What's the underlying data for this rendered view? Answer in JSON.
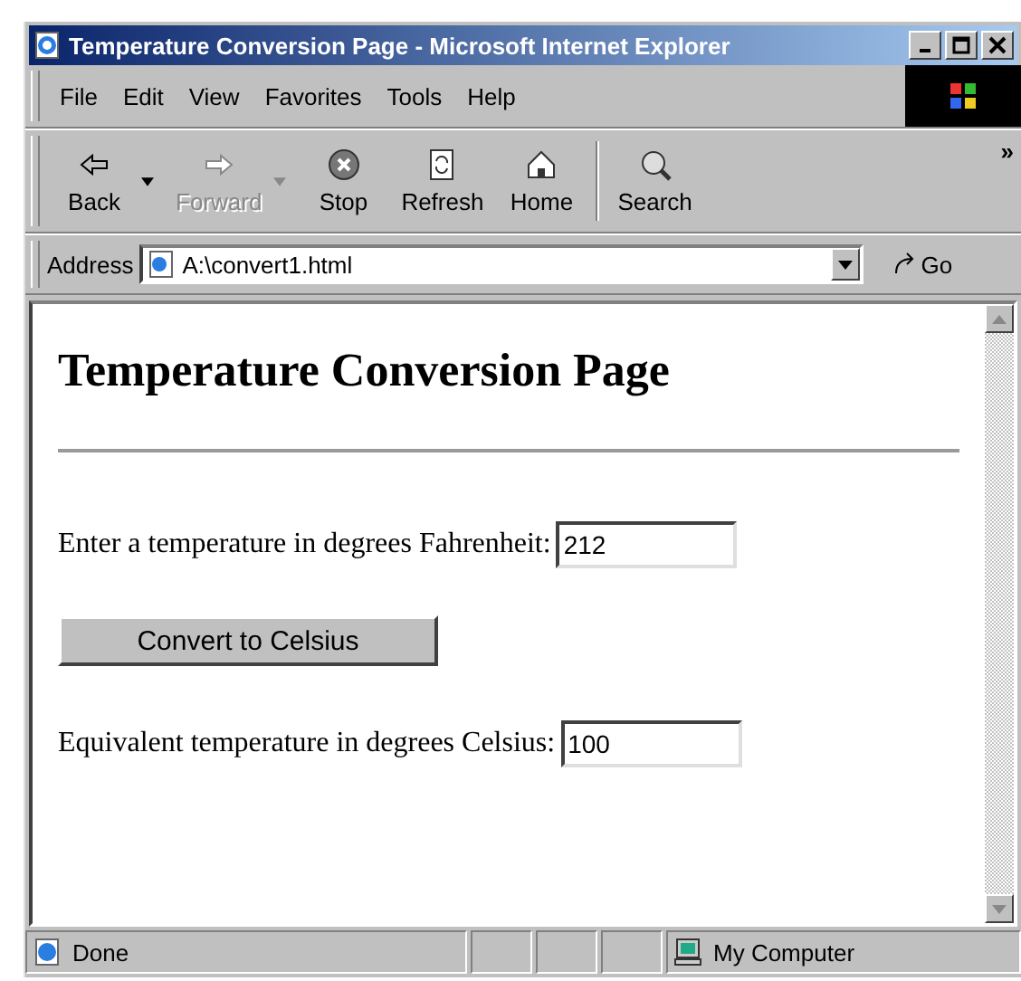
{
  "window": {
    "title": "Temperature Conversion Page - Microsoft Internet Explorer"
  },
  "menu": [
    "File",
    "Edit",
    "View",
    "Favorites",
    "Tools",
    "Help"
  ],
  "toolbar": [
    {
      "kind": "back",
      "label": "Back",
      "disabled": false,
      "dropdown": true
    },
    {
      "kind": "forward",
      "label": "Forward",
      "disabled": true,
      "dropdown": true
    },
    {
      "kind": "stop",
      "label": "Stop",
      "disabled": false,
      "dropdown": false
    },
    {
      "kind": "refresh",
      "label": "Refresh",
      "disabled": false,
      "dropdown": false
    },
    {
      "kind": "home",
      "label": "Home",
      "disabled": false,
      "dropdown": false
    },
    {
      "kind": "search",
      "label": "Search",
      "disabled": false,
      "dropdown": false
    }
  ],
  "toolbar_more": "»",
  "address": {
    "label": "Address",
    "value": "A:\\convert1.html",
    "go": "Go"
  },
  "page": {
    "heading": "Temperature Conversion Page",
    "fahrenheit": {
      "label": "Enter a temperature in degrees Fahrenheit:",
      "value": "212"
    },
    "button": "Convert to Celsius",
    "celsius": {
      "label": "Equivalent temperature in degrees Celsius:",
      "value": "100"
    }
  },
  "status_bar": {
    "text": "Done",
    "zone": "My Computer"
  }
}
